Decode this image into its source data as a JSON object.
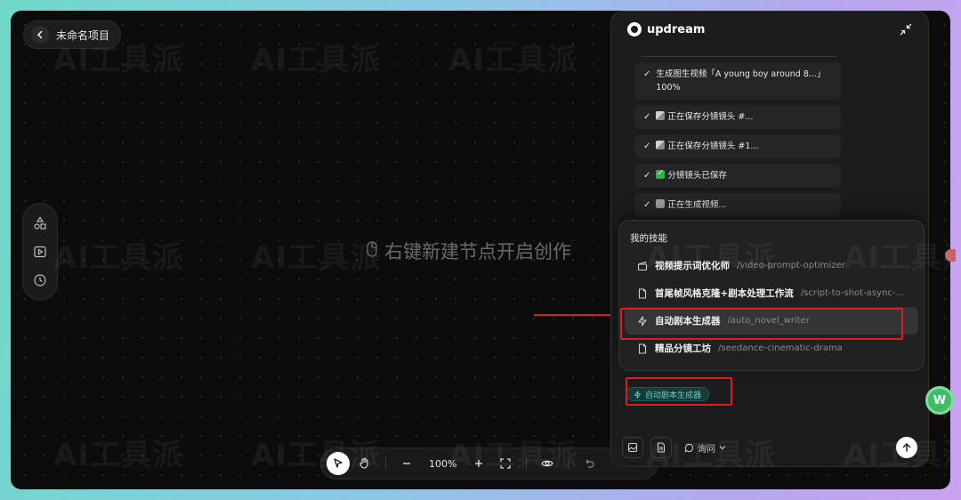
{
  "project": {
    "title": "未命名项目"
  },
  "canvas": {
    "hint": "右键新建节点开启创作",
    "watermark": "AI工具派",
    "zoom": "100%"
  },
  "panel": {
    "brand": "updream",
    "steps": [
      {
        "line1": "生成图生视频「A young boy around 8...」",
        "line2": "100%"
      },
      {
        "emoji": "clap",
        "text": "正在保存分镜镜头 #..."
      },
      {
        "emoji": "clap",
        "text": "正在保存分镜镜头 #1..."
      },
      {
        "emoji": "green",
        "text": "分镜镜头已保存"
      },
      {
        "emoji": "cam",
        "text": "正在生成视频..."
      }
    ],
    "skills_title": "我的技能",
    "skills": [
      {
        "name": "视频提示词优化师",
        "slug": "/video-prompt-optimizer",
        "icon": "clapper-icon"
      },
      {
        "name": "首尾帧风格克隆+剧本处理工作流",
        "slug": "/script-to-shot-async-...",
        "icon": "file-icon"
      },
      {
        "name": "自动剧本生成器",
        "slug": "/auto_novel_writer",
        "icon": "bolt-icon"
      },
      {
        "name": "精品分镜工坊",
        "slug": "/seedance-cinematic-drama",
        "icon": "file-icon"
      }
    ],
    "selected_skill_chip": "自动剧本生成器",
    "mode_label": "询问"
  },
  "floating": {
    "w_label": "W"
  },
  "colors": {
    "annotation_red": "#e01b1b",
    "chip_teal": "#5fd3c2",
    "float_green": "#3ebd64"
  }
}
